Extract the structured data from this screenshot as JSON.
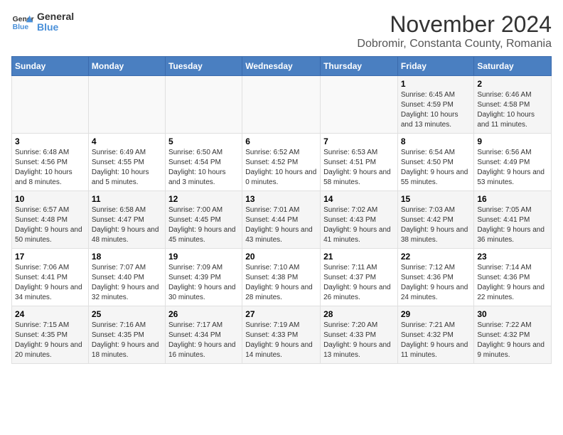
{
  "header": {
    "logo_general": "General",
    "logo_blue": "Blue",
    "month_title": "November 2024",
    "location": "Dobromir, Constanta County, Romania"
  },
  "weekdays": [
    "Sunday",
    "Monday",
    "Tuesday",
    "Wednesday",
    "Thursday",
    "Friday",
    "Saturday"
  ],
  "weeks": [
    [
      {
        "day": "",
        "info": ""
      },
      {
        "day": "",
        "info": ""
      },
      {
        "day": "",
        "info": ""
      },
      {
        "day": "",
        "info": ""
      },
      {
        "day": "",
        "info": ""
      },
      {
        "day": "1",
        "info": "Sunrise: 6:45 AM\nSunset: 4:59 PM\nDaylight: 10 hours and 13 minutes."
      },
      {
        "day": "2",
        "info": "Sunrise: 6:46 AM\nSunset: 4:58 PM\nDaylight: 10 hours and 11 minutes."
      }
    ],
    [
      {
        "day": "3",
        "info": "Sunrise: 6:48 AM\nSunset: 4:56 PM\nDaylight: 10 hours and 8 minutes."
      },
      {
        "day": "4",
        "info": "Sunrise: 6:49 AM\nSunset: 4:55 PM\nDaylight: 10 hours and 5 minutes."
      },
      {
        "day": "5",
        "info": "Sunrise: 6:50 AM\nSunset: 4:54 PM\nDaylight: 10 hours and 3 minutes."
      },
      {
        "day": "6",
        "info": "Sunrise: 6:52 AM\nSunset: 4:52 PM\nDaylight: 10 hours and 0 minutes."
      },
      {
        "day": "7",
        "info": "Sunrise: 6:53 AM\nSunset: 4:51 PM\nDaylight: 9 hours and 58 minutes."
      },
      {
        "day": "8",
        "info": "Sunrise: 6:54 AM\nSunset: 4:50 PM\nDaylight: 9 hours and 55 minutes."
      },
      {
        "day": "9",
        "info": "Sunrise: 6:56 AM\nSunset: 4:49 PM\nDaylight: 9 hours and 53 minutes."
      }
    ],
    [
      {
        "day": "10",
        "info": "Sunrise: 6:57 AM\nSunset: 4:48 PM\nDaylight: 9 hours and 50 minutes."
      },
      {
        "day": "11",
        "info": "Sunrise: 6:58 AM\nSunset: 4:47 PM\nDaylight: 9 hours and 48 minutes."
      },
      {
        "day": "12",
        "info": "Sunrise: 7:00 AM\nSunset: 4:45 PM\nDaylight: 9 hours and 45 minutes."
      },
      {
        "day": "13",
        "info": "Sunrise: 7:01 AM\nSunset: 4:44 PM\nDaylight: 9 hours and 43 minutes."
      },
      {
        "day": "14",
        "info": "Sunrise: 7:02 AM\nSunset: 4:43 PM\nDaylight: 9 hours and 41 minutes."
      },
      {
        "day": "15",
        "info": "Sunrise: 7:03 AM\nSunset: 4:42 PM\nDaylight: 9 hours and 38 minutes."
      },
      {
        "day": "16",
        "info": "Sunrise: 7:05 AM\nSunset: 4:41 PM\nDaylight: 9 hours and 36 minutes."
      }
    ],
    [
      {
        "day": "17",
        "info": "Sunrise: 7:06 AM\nSunset: 4:41 PM\nDaylight: 9 hours and 34 minutes."
      },
      {
        "day": "18",
        "info": "Sunrise: 7:07 AM\nSunset: 4:40 PM\nDaylight: 9 hours and 32 minutes."
      },
      {
        "day": "19",
        "info": "Sunrise: 7:09 AM\nSunset: 4:39 PM\nDaylight: 9 hours and 30 minutes."
      },
      {
        "day": "20",
        "info": "Sunrise: 7:10 AM\nSunset: 4:38 PM\nDaylight: 9 hours and 28 minutes."
      },
      {
        "day": "21",
        "info": "Sunrise: 7:11 AM\nSunset: 4:37 PM\nDaylight: 9 hours and 26 minutes."
      },
      {
        "day": "22",
        "info": "Sunrise: 7:12 AM\nSunset: 4:36 PM\nDaylight: 9 hours and 24 minutes."
      },
      {
        "day": "23",
        "info": "Sunrise: 7:14 AM\nSunset: 4:36 PM\nDaylight: 9 hours and 22 minutes."
      }
    ],
    [
      {
        "day": "24",
        "info": "Sunrise: 7:15 AM\nSunset: 4:35 PM\nDaylight: 9 hours and 20 minutes."
      },
      {
        "day": "25",
        "info": "Sunrise: 7:16 AM\nSunset: 4:35 PM\nDaylight: 9 hours and 18 minutes."
      },
      {
        "day": "26",
        "info": "Sunrise: 7:17 AM\nSunset: 4:34 PM\nDaylight: 9 hours and 16 minutes."
      },
      {
        "day": "27",
        "info": "Sunrise: 7:19 AM\nSunset: 4:33 PM\nDaylight: 9 hours and 14 minutes."
      },
      {
        "day": "28",
        "info": "Sunrise: 7:20 AM\nSunset: 4:33 PM\nDaylight: 9 hours and 13 minutes."
      },
      {
        "day": "29",
        "info": "Sunrise: 7:21 AM\nSunset: 4:32 PM\nDaylight: 9 hours and 11 minutes."
      },
      {
        "day": "30",
        "info": "Sunrise: 7:22 AM\nSunset: 4:32 PM\nDaylight: 9 hours and 9 minutes."
      }
    ]
  ]
}
